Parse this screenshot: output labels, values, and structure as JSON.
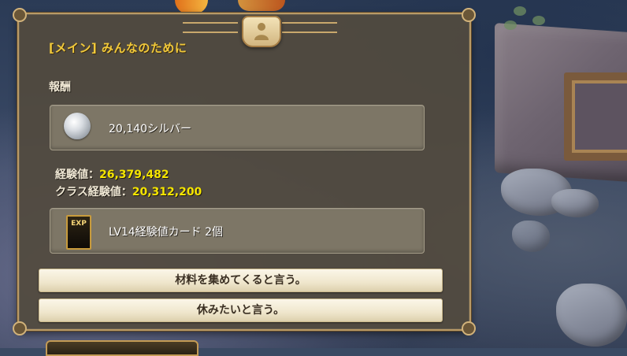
{
  "dialog": {
    "title": "[メイン] みんなのために",
    "reward_section_label": "報酬",
    "rewards": [
      {
        "icon": "silver-coin-icon",
        "label": "20,140シルバー"
      },
      {
        "icon": "exp-card-icon",
        "icon_text": "EXP",
        "label": "LV14経験値カード 2個"
      }
    ],
    "experience": {
      "label": "経験値：",
      "value": "26,379,482"
    },
    "class_experience": {
      "label": "クラス経験値：",
      "value": "20,312,200"
    },
    "choices": [
      {
        "label": "材料を集めてくると言う。"
      },
      {
        "label": "休みたいと言う。"
      }
    ]
  },
  "colors": {
    "title": "#f1c93a",
    "value_highlight": "#f5e500",
    "panel_border": "#b99a66"
  }
}
